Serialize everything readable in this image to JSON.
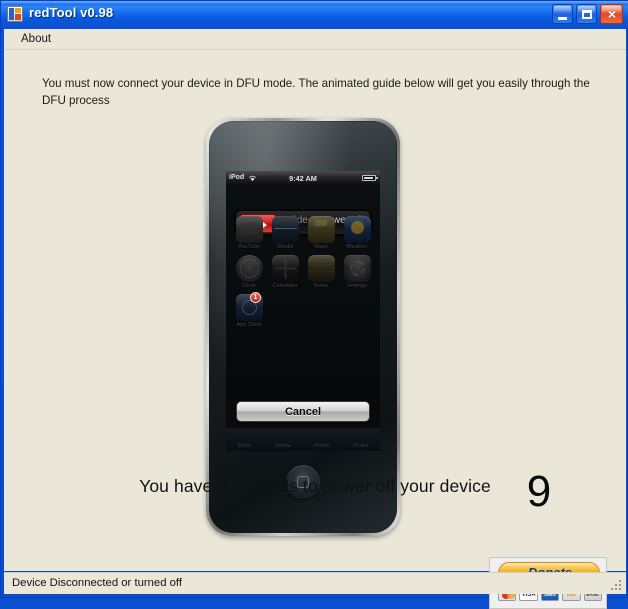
{
  "window": {
    "title": "redTool v0.98",
    "app_icon": "form-icon",
    "controls": {
      "minimize": "minimize-icon",
      "maximize": "maximize-icon",
      "close": "×"
    }
  },
  "menu": {
    "items": [
      "About"
    ]
  },
  "main": {
    "instructions": "You must now connect your device in DFU mode. The animated guide below will get you easily through the DFU process",
    "countdown": "9",
    "message": "You have 9 seconds to power off your device"
  },
  "device": {
    "type": "ipod-touch",
    "ios_status": {
      "carrier": "iPod",
      "wifi_icon": "wifi-icon",
      "time": "9:42 AM",
      "battery_icon": "battery-icon"
    },
    "power_slider": {
      "label": "slide to power off",
      "arrow_icon": "arrow-right-icon"
    },
    "cancel_label": "Cancel",
    "apps": [
      {
        "label": "YouTube",
        "icon": "youtube-icon"
      },
      {
        "label": "Stocks",
        "icon": "stocks-icon"
      },
      {
        "label": "Maps",
        "icon": "maps-icon"
      },
      {
        "label": "Weather",
        "icon": "weather-icon"
      },
      {
        "label": "Clock",
        "icon": "clock-icon"
      },
      {
        "label": "Calculator",
        "icon": "calculator-icon"
      },
      {
        "label": "Notes",
        "icon": "notes-icon"
      },
      {
        "label": "Settings",
        "icon": "settings-icon"
      },
      {
        "label": "App Store",
        "icon": "appstore-icon",
        "badge": "1"
      }
    ],
    "dock": [
      "Music",
      "Videos",
      "Photos",
      "iTunes"
    ],
    "home_button": "home-button"
  },
  "donate": {
    "label": "Donate",
    "cards": [
      {
        "name": "mastercard",
        "text": ""
      },
      {
        "name": "visa",
        "text": "VISA"
      },
      {
        "name": "american-express",
        "text": "AMEX"
      },
      {
        "name": "discover",
        "text": "DISC"
      },
      {
        "name": "bank",
        "text": "BANK"
      }
    ]
  },
  "statusbar": {
    "text": "Device Disconnected or turned off"
  },
  "colors": {
    "client_background": "#EAE7D8",
    "titlebar_blue": "#1570EE",
    "slider_red": "#C8211C",
    "donate_orange": "#F2A91C"
  }
}
